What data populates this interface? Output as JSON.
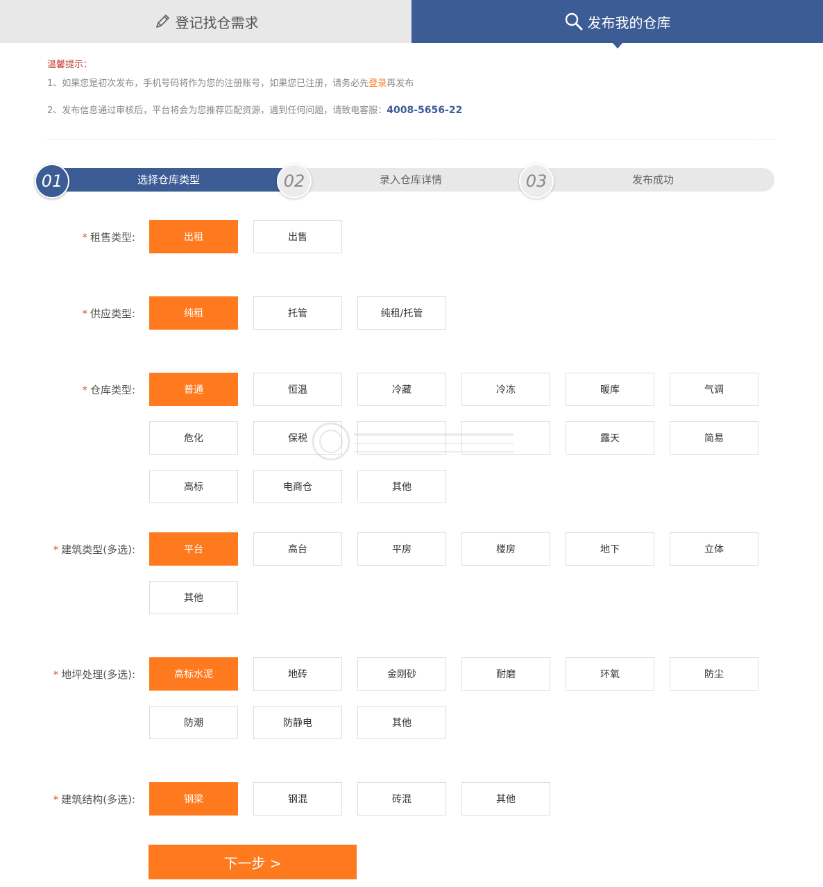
{
  "tabs": {
    "left": "登记找仓需求",
    "right": "发布我的仓库"
  },
  "tips": {
    "title": "温馨提示：",
    "line1_pre": "1、如果您是初次发布，手机号码将作为您的注册账号，如果您已注册，请务必先",
    "line1_link": "登录",
    "line1_post": "再发布",
    "line2_pre": "2、发布信息通过审核后，平台将会为您推荐匹配资源，遇到任何问题，请致电客服：",
    "line2_phone": "4008-5656-22"
  },
  "steps": [
    {
      "num": "01",
      "label": "选择仓库类型"
    },
    {
      "num": "02",
      "label": "录入仓库详情"
    },
    {
      "num": "03",
      "label": "发布成功"
    }
  ],
  "rows": {
    "rent": {
      "label": "租售类型:",
      "options": [
        "出租",
        "出售"
      ]
    },
    "supply": {
      "label": "供应类型:",
      "options": [
        "纯租",
        "托管",
        "纯租/托管"
      ]
    },
    "warehouse": {
      "label": "仓库类型:",
      "options": [
        "普通",
        "恒温",
        "冷藏",
        "冷冻",
        "暖库",
        "气调",
        "危化",
        "保税",
        "",
        "",
        "露天",
        "简易",
        "高标",
        "电商仓",
        "其他"
      ]
    },
    "building": {
      "label": "建筑类型(多选):",
      "options": [
        "平台",
        "高台",
        "平房",
        "楼房",
        "地下",
        "立体",
        "其他"
      ]
    },
    "floor": {
      "label": "地坪处理(多选):",
      "options": [
        "高标水泥",
        "地砖",
        "金刚砂",
        "耐磨",
        "环氧",
        "防尘",
        "防潮",
        "防静电",
        "其他"
      ]
    },
    "structure": {
      "label": "建筑结构(多选):",
      "options": [
        "钢梁",
        "钢混",
        "砖混",
        "其他"
      ]
    }
  },
  "next_button": "下一步 >",
  "colors": {
    "primary": "#3b5c94",
    "accent": "#ff7a1f"
  }
}
